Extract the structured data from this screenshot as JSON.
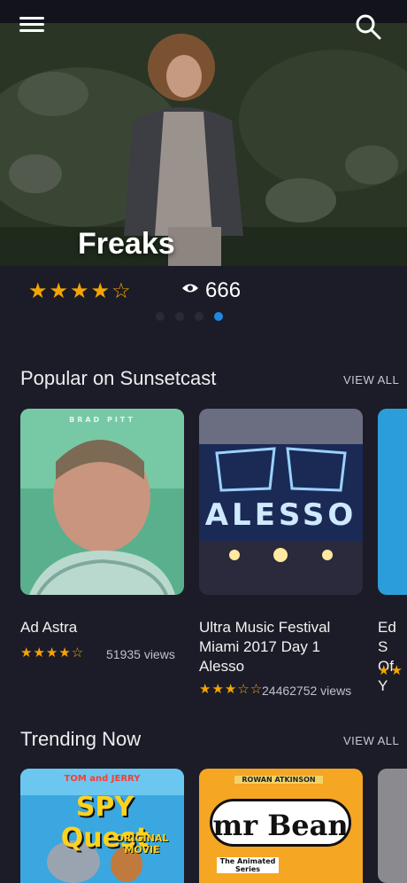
{
  "header": {
    "menu_icon": "hamburger-menu-icon",
    "search_icon": "search-icon"
  },
  "hero": {
    "title": "Freaks",
    "stars": "★★★★☆",
    "rating": 4,
    "views": "666",
    "carousel": {
      "count": 4,
      "active_index": 3
    }
  },
  "popular": {
    "title": "Popular on Sunsetcast",
    "view_all": "VIEW ALL",
    "items": [
      {
        "title": "Ad Astra",
        "stars": "★★★★☆",
        "views": "51935 views",
        "poster_caption": "BRAD PITT"
      },
      {
        "title": "Ultra Music Festival Miami 2017 Day 1 Alesso",
        "stars": "★★★☆☆",
        "views": "24462752 views",
        "poster_caption": "ALESSO"
      },
      {
        "title": "Ed S Of Y",
        "stars": "★★"
      }
    ]
  },
  "trending": {
    "title": "Trending Now",
    "view_all": "VIEW ALL",
    "items": [
      {
        "poster_caption_1": "TOM and JERRY",
        "poster_caption_2": "SPY Quest",
        "poster_caption_3": "ORIGINAL MOVIE"
      },
      {
        "poster_caption_1": "ROWAN ATKINSON",
        "poster_caption_2": "mr Bean",
        "poster_caption_3": "The Animated Series"
      },
      {}
    ]
  },
  "colors": {
    "background": "#1c1c28",
    "star": "#f5a500",
    "accent": "#1e88e5"
  }
}
